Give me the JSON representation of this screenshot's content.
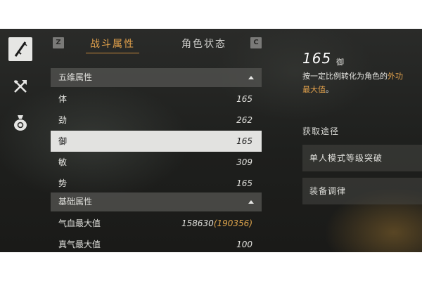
{
  "sidebar": {
    "items": [
      {
        "icon": "sword-icon",
        "active": true
      },
      {
        "icon": "crossed-tools-icon",
        "active": false
      },
      {
        "icon": "money-bag-icon",
        "active": false
      }
    ]
  },
  "tabs": {
    "left_key": "Z",
    "right_key": "C",
    "items": [
      {
        "label": "战斗属性",
        "active": true
      },
      {
        "label": "角色状态",
        "active": false
      }
    ]
  },
  "sections": [
    {
      "title": "五维属性",
      "expanded": true,
      "rows": [
        {
          "label": "体",
          "value": "165"
        },
        {
          "label": "劲",
          "value": "262"
        },
        {
          "label": "御",
          "value": "165",
          "selected": true
        },
        {
          "label": "敏",
          "value": "309"
        },
        {
          "label": "势",
          "value": "165"
        }
      ]
    },
    {
      "title": "基础属性",
      "expanded": true,
      "rows": [
        {
          "label": "气血最大值",
          "value": "158630",
          "bonus_open": "(",
          "bonus": "190356",
          "bonus_close": ")"
        },
        {
          "label": "真气最大值",
          "value": "100"
        }
      ]
    }
  ],
  "detail": {
    "value": "165",
    "name": "御",
    "desc_line1": "按一定比例转化为角色的",
    "desc_line1_highlight": "外功",
    "desc_line2_highlight": "最大值",
    "desc_line2_end": "。",
    "sources_title": "获取途径",
    "sources": [
      "单人模式等级突破",
      "装备调律"
    ]
  },
  "colors": {
    "accent": "#e3a24c",
    "selected_row": "#e2e2e0",
    "section_header": "#50504e"
  }
}
